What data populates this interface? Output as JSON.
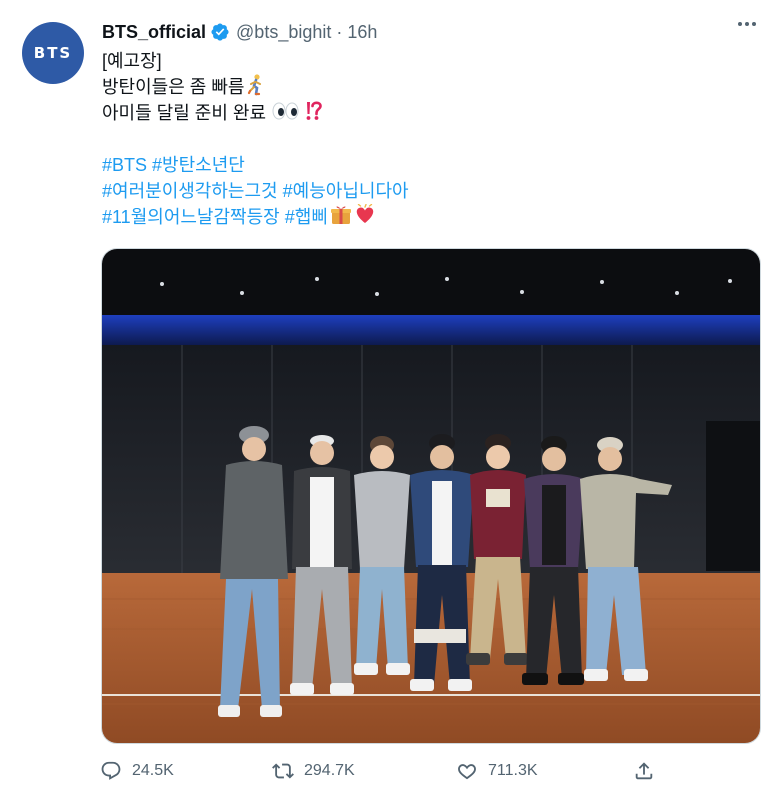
{
  "tweet": {
    "avatar_text": "BTS",
    "display_name": "BTS_official",
    "verified": true,
    "handle": "@bts_bighit",
    "separator": "·",
    "time": "16h",
    "text": {
      "line1": "[예고장]",
      "line2": "방탄이들은 좀 빠름",
      "line2_emoji": "running-man-emoji",
      "line3": "아미들 달릴 준비 완료",
      "line3_emoji": "eyes-and-exclamation-question-emoji",
      "tags1": [
        "#BTS",
        "#방탄소년단"
      ],
      "tags2": [
        "#여러분이생각하는그것",
        "#예능아닙니다아"
      ],
      "tags3": [
        "#11월의어느날감짝등장",
        "#햅삐"
      ],
      "tags3_emoji": "gift-and-heart-emoji"
    },
    "media": {
      "description_icon": "group-photo-seven-people-dance-studio"
    },
    "actions": {
      "replies": "24.5K",
      "retweets": "294.7K",
      "likes": "711.3K"
    }
  },
  "colors": {
    "accent": "#1d9bf0",
    "text": "#0f1419",
    "muted": "#536471",
    "avatar_bg": "#2e5aa6"
  }
}
